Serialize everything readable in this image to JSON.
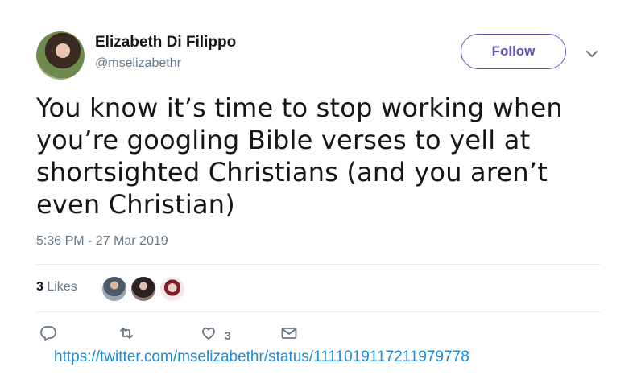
{
  "author": {
    "display_name": "Elizabeth Di Filippo",
    "handle": "@mselizabethr",
    "avatar_icon": "profile-photo"
  },
  "follow_button": {
    "label": "Follow"
  },
  "menu": {
    "icon": "chevron-down-icon"
  },
  "tweet": {
    "text": "You know it’s time to stop working when you’re googling Bible verses to yell at shortsighted Christians (and you aren’t even Christian)",
    "timestamp": "5:36 PM - 27 Mar 2019"
  },
  "stats": {
    "likes_number": "3",
    "likes_label": " Likes"
  },
  "actions": {
    "reply_icon": "reply-icon",
    "retweet_icon": "retweet-icon",
    "like_icon": "heart-icon",
    "like_count": "3",
    "dm_icon": "envelope-icon"
  },
  "url": "https://twitter.com/mselizabethr/status/1111019117211979778",
  "colors": {
    "accent": "#6b4fbb",
    "secondary_text": "#657786",
    "link": "#1a8cd8",
    "divider": "#e6ecf0"
  }
}
